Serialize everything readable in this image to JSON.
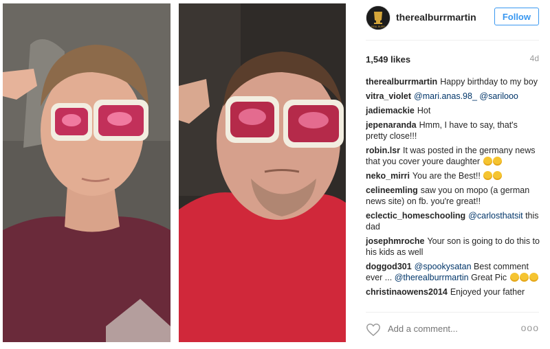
{
  "post": {
    "username": "therealburrmartin",
    "follow_label": "Follow",
    "likes": "1,549 likes",
    "time": "4d",
    "add_comment_placeholder": "Add a comment...",
    "more_label": "ooo",
    "avatar_text": "REAL BURR"
  },
  "comments": [
    {
      "user": "therealburrmartin",
      "text": "Happy birthday to my boy"
    },
    {
      "user": "vitra_violet",
      "mention": "@mari.anas.98_ @sarilooo",
      "text": ""
    },
    {
      "user": "jadiemackie",
      "text": "Hot"
    },
    {
      "user": "jepenaranda",
      "text": "Hmm, I have to say, that's pretty close!!!"
    },
    {
      "user": "robin.lsr",
      "text": "It was posted in the germany news that you cover youre daughter"
    },
    {
      "user": "neko_mirri",
      "text": "You are the Best!!"
    },
    {
      "user": "celineemling",
      "text": "saw you on mopo (a german news site) on fb. you're great!!"
    },
    {
      "user": "eclectic_homeschooling",
      "mention": "@carlosthatsit",
      "text": "this dad"
    },
    {
      "user": "josephmroche",
      "text": "Your son is going to do this to his kids as well"
    },
    {
      "user": "doggod301",
      "mention": "@spookysatan",
      "text": "Best comment ever ...",
      "mention2": "@therealburrmartin",
      "text2": "Great Pic"
    },
    {
      "user": "christinaowens2014",
      "text": "Enjoyed your father"
    }
  ],
  "colors": {
    "accent": "#3897f0",
    "link": "#003569"
  }
}
